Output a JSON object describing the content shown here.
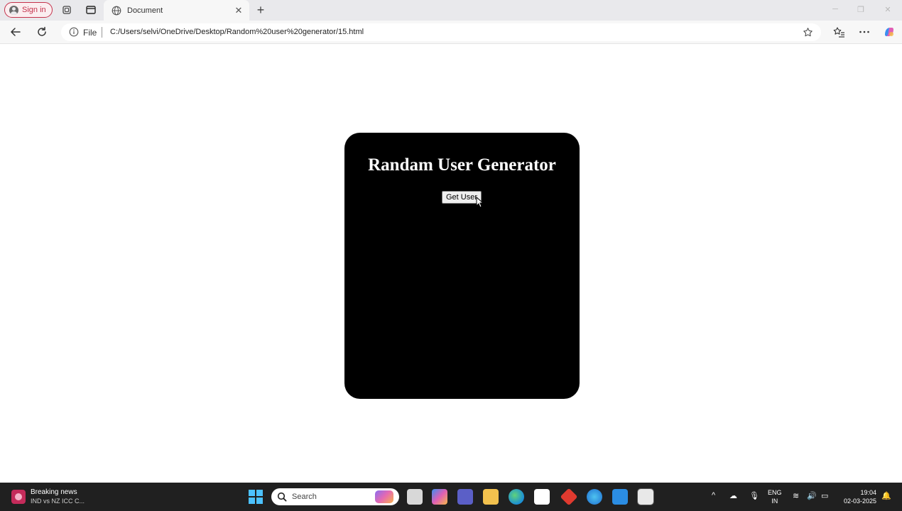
{
  "browser": {
    "sign_in_label": "Sign in",
    "tab_title": "Document",
    "tab_close": "✕",
    "new_tab": "+",
    "win_minimize": "─",
    "win_restore": "❐",
    "win_close": "✕",
    "address_scheme": "File",
    "address_url": "C:/Users/selvi/OneDrive/Desktop/Random%20user%20generator/15.html"
  },
  "page": {
    "heading": "Randam User Generator",
    "get_user_label": "Get User"
  },
  "taskbar": {
    "news_title": "Breaking news",
    "news_subtitle": "IND vs NZ ICC C...",
    "search_placeholder": "Search",
    "lang_line1": "ENG",
    "lang_line2": "IN",
    "time": "19:04",
    "date": "02-03-2025"
  },
  "colors": {
    "card": "#000000",
    "signin_accent": "#c4314b",
    "taskbar": "#202020",
    "windows_blue": "#4cc2ff"
  }
}
